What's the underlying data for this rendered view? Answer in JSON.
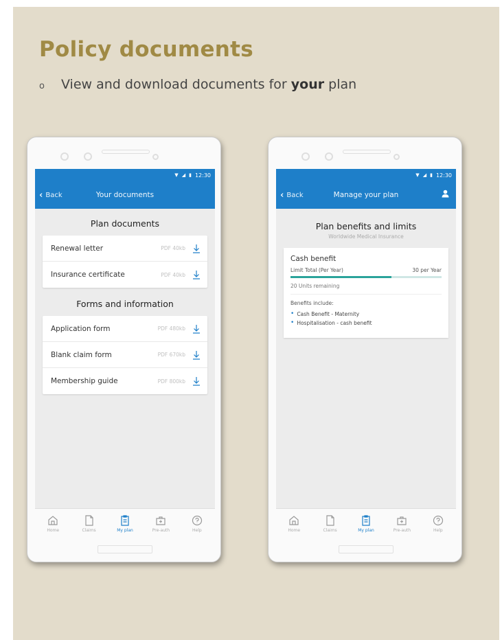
{
  "slide": {
    "title": "Policy documents",
    "bullet_prefix": "View and download documents for ",
    "bullet_bold": "your",
    "bullet_suffix": " plan"
  },
  "status": {
    "time": "12:30"
  },
  "left_screen": {
    "back_label": "Back",
    "title": "Your documents",
    "section1_title": "Plan documents",
    "plan_documents": [
      {
        "name": "Renewal letter",
        "meta": "PDF 40kb"
      },
      {
        "name": "Insurance certificate",
        "meta": "PDF 40kb"
      }
    ],
    "section2_title": "Forms and information",
    "forms": [
      {
        "name": "Application form",
        "meta": "PDF 480kb"
      },
      {
        "name": "Blank claim form",
        "meta": "PDF 670kb"
      },
      {
        "name": "Membership guide",
        "meta": "PDF 800kb"
      }
    ]
  },
  "right_screen": {
    "back_label": "Back",
    "title": "Manage your plan",
    "heading": "Plan benefits and limits",
    "subheading": "Worldwide Medical Insurance",
    "card_title": "Cash benefit",
    "limit_label": "Limit Total (Per Year)",
    "limit_value": "30 per Year",
    "progress_fraction": 0.67,
    "remaining": "20 Units remaining",
    "includes_label": "Benefits include:",
    "includes": [
      "Cash Benefit - Maternity",
      "Hospitalisation - cash benefit"
    ]
  },
  "tabs": [
    "Home",
    "Claims",
    "My plan",
    "Pre-auth",
    "Help"
  ],
  "colors": {
    "accent": "#1e7fc9",
    "title_gold": "#a08a45",
    "background": "#e3dccb",
    "progress": "#2aa39a"
  }
}
